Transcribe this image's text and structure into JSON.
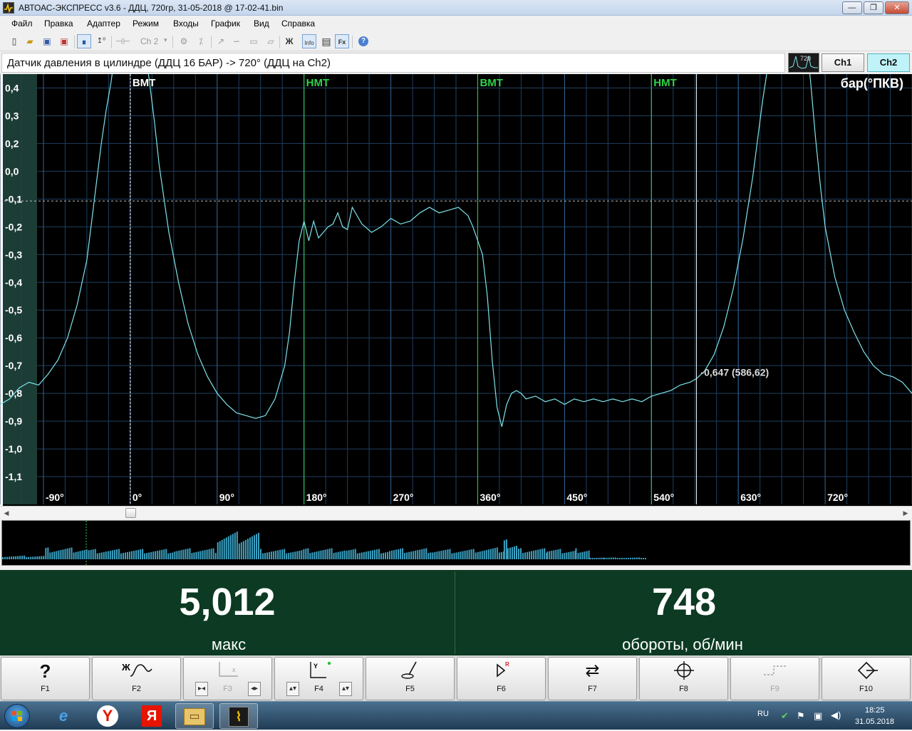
{
  "window": {
    "title": "АВТОАС-ЭКСПРЕСС v3.6 - ДДЦ, 720гр, 31-05-2018 @ 17-02-41.bin",
    "controls": {
      "minimize": "—",
      "restore": "❐",
      "close": "✕"
    }
  },
  "menu": [
    "Файл",
    "Правка",
    "Адаптер",
    "Режим",
    "Входы",
    "График",
    "Вид",
    "Справка"
  ],
  "toolbar": {
    "channel": "Ch 2",
    "icons": [
      "new-file-icon",
      "open-folder-icon",
      "save-icon",
      "delete-icon",
      "pause-icon",
      "pulse-icon",
      "sync-icon",
      "filter-icon",
      "zoom-icon",
      "folder-icon",
      "info-icon",
      "filter-fx-icon",
      "help-icon"
    ],
    "info_label": "Info",
    "fx_label": "Fx",
    "zh_label": "Ж"
  },
  "channel_header": {
    "signal": "Датчик давления в цилиндре (ДДЦ 16 БАР) -> 720° (ДДЦ на Ch2)",
    "thumb_label": "720",
    "ch1": "Ch1",
    "ch2": "Ch2",
    "active_channel": "Ch2"
  },
  "chart_data": {
    "type": "line",
    "units_label": "бар(°ПКВ)",
    "xlim": [
      -135,
      810
    ],
    "ylim": [
      -1.1,
      0.45
    ],
    "x_ticks": [
      {
        "x": -90,
        "label": "-90°"
      },
      {
        "x": 0,
        "label": "0°"
      },
      {
        "x": 90,
        "label": "90°"
      },
      {
        "x": 180,
        "label": "180°"
      },
      {
        "x": 270,
        "label": "270°"
      },
      {
        "x": 360,
        "label": "360°"
      },
      {
        "x": 450,
        "label": "450°"
      },
      {
        "x": 540,
        "label": "540°"
      },
      {
        "x": 630,
        "label": "630°"
      },
      {
        "x": 720,
        "label": "720°"
      }
    ],
    "y_ticks": [
      {
        "y": 0.4,
        "label": "0,4"
      },
      {
        "y": 0.3,
        "label": "0,3"
      },
      {
        "y": 0.2,
        "label": "0,2"
      },
      {
        "y": 0.1,
        "label": "0,0"
      },
      {
        "y": 0.0,
        "label": "-0,1"
      },
      {
        "y": -0.1,
        "label": "-0,2"
      },
      {
        "y": -0.2,
        "label": "-0,3"
      },
      {
        "y": -0.3,
        "label": "-0,4"
      },
      {
        "y": -0.4,
        "label": "-0,5"
      },
      {
        "y": -0.5,
        "label": "-0,6"
      },
      {
        "y": -0.6,
        "label": "-0,7"
      },
      {
        "y": -0.7,
        "label": "-0,8"
      },
      {
        "y": -0.8,
        "label": "-0,9"
      },
      {
        "y": -0.9,
        "label": "-1,0"
      },
      {
        "y": -1.0,
        "label": "-1,1"
      }
    ],
    "markers": [
      {
        "x": 0,
        "label": "ВМТ",
        "color": "#ffffff"
      },
      {
        "x": 180,
        "label": "НМТ",
        "color": "#32d24a"
      },
      {
        "x": 360,
        "label": "ВМТ",
        "color": "#32d24a"
      },
      {
        "x": 540,
        "label": "НМТ",
        "color": "#32d24a"
      }
    ],
    "cursor": {
      "x": 586.62,
      "y": -0.647,
      "label": "-0,647 (586,62)"
    },
    "zero_line": -0.007,
    "grid": true,
    "line_color": "#7fe3ea",
    "series": [
      {
        "x": [
          -135,
          -125,
          -115,
          -105,
          -95,
          -85,
          -75,
          -65,
          -55,
          -45,
          -40,
          -35,
          -30,
          -25,
          -20,
          -15,
          -10,
          0,
          10,
          15,
          20,
          25,
          30,
          40,
          50,
          60,
          70,
          80,
          90,
          100,
          110,
          120,
          130,
          140,
          150,
          160,
          165,
          170,
          175,
          180,
          185,
          190,
          195,
          200,
          205,
          210,
          215,
          220,
          225,
          230,
          240,
          250,
          260,
          270,
          280,
          290,
          300,
          310,
          320,
          330,
          340,
          350,
          355,
          360,
          365,
          370,
          375,
          380,
          385,
          390,
          395,
          400,
          405,
          410,
          420,
          430,
          440,
          450,
          460,
          470,
          480,
          490,
          500,
          510,
          520,
          530,
          540,
          550,
          560,
          570,
          580,
          586.62,
          595,
          605,
          615,
          625,
          635,
          645,
          655,
          665,
          670,
          675,
          680,
          695,
          700,
          705,
          710,
          715,
          720,
          730,
          740,
          750,
          760,
          770,
          780,
          790,
          800,
          810
        ],
        "y": [
          -0.74,
          -0.72,
          -0.68,
          -0.66,
          -0.67,
          -0.63,
          -0.58,
          -0.5,
          -0.38,
          -0.22,
          -0.08,
          0.06,
          0.2,
          0.32,
          0.42,
          0.55,
          0.7,
          0.7,
          0.7,
          0.55,
          0.42,
          0.28,
          0.12,
          -0.12,
          -0.3,
          -0.45,
          -0.56,
          -0.64,
          -0.7,
          -0.74,
          -0.77,
          -0.78,
          -0.79,
          -0.78,
          -0.72,
          -0.6,
          -0.48,
          -0.3,
          -0.15,
          -0.08,
          -0.15,
          -0.08,
          -0.14,
          -0.12,
          -0.1,
          -0.09,
          -0.05,
          -0.1,
          -0.11,
          -0.03,
          -0.09,
          -0.12,
          -0.1,
          -0.07,
          -0.09,
          -0.08,
          -0.05,
          -0.03,
          -0.05,
          -0.04,
          -0.03,
          -0.06,
          -0.1,
          -0.15,
          -0.2,
          -0.35,
          -0.58,
          -0.75,
          -0.82,
          -0.74,
          -0.7,
          -0.69,
          -0.7,
          -0.72,
          -0.71,
          -0.73,
          -0.72,
          -0.74,
          -0.72,
          -0.73,
          -0.72,
          -0.73,
          -0.72,
          -0.73,
          -0.72,
          -0.73,
          -0.71,
          -0.7,
          -0.69,
          -0.67,
          -0.66,
          -0.647,
          -0.62,
          -0.56,
          -0.46,
          -0.32,
          -0.14,
          0.08,
          0.35,
          0.62,
          0.7,
          0.7,
          0.7,
          0.7,
          0.62,
          0.42,
          0.22,
          0.05,
          -0.1,
          -0.28,
          -0.4,
          -0.48,
          -0.55,
          -0.6,
          -0.63,
          -0.64,
          -0.66,
          -0.7
        ]
      }
    ]
  },
  "overview": {
    "x": [
      0,
      60,
      120,
      240,
      300,
      360,
      420,
      480,
      540,
      600,
      660,
      700,
      705,
      720,
      760,
      800,
      820,
      840,
      900
    ],
    "level": [
      0.1,
      0.32,
      0.28,
      0.3,
      0.75,
      0.28,
      0.3,
      0.28,
      0.3,
      0.28,
      0.32,
      0.62,
      0.4,
      0.3,
      0.28,
      0.3,
      0.05,
      0.05,
      0.05
    ]
  },
  "readouts": [
    {
      "value": "5,012",
      "caption": "макс"
    },
    {
      "value": "748",
      "caption": "обороты, об/мин"
    }
  ],
  "fkeys": [
    {
      "label": "F1",
      "icon": "?",
      "name": "help"
    },
    {
      "label": "F2",
      "icon": "Ж∿",
      "name": "zh-wave"
    },
    {
      "label": "F3",
      "icon": "↦",
      "name": "x-axis",
      "dim": true
    },
    {
      "label": "F4",
      "icon": "Y",
      "name": "y-axis"
    },
    {
      "label": "F5",
      "icon": "⌕",
      "name": "probe"
    },
    {
      "label": "F6",
      "icon": "▷",
      "name": "record-trigger"
    },
    {
      "label": "F7",
      "icon": "⇄",
      "name": "swap"
    },
    {
      "label": "F8",
      "icon": "⊕",
      "name": "crosshair"
    },
    {
      "label": "F9",
      "icon": "⌐",
      "name": "step",
      "dim": true
    },
    {
      "label": "F10",
      "icon": "◇",
      "name": "nav"
    }
  ],
  "taskbar": {
    "apps": [
      {
        "name": "ie-icon",
        "glyph": "e"
      },
      {
        "name": "yandex-browser-icon",
        "glyph": "Y"
      },
      {
        "name": "yandex-icon",
        "glyph": "Я"
      },
      {
        "name": "explorer-icon",
        "glyph": "▭"
      },
      {
        "name": "avtoas-icon",
        "glyph": "⌇"
      }
    ],
    "lang": "RU",
    "time": "18:25",
    "date": "31.05.2018"
  }
}
